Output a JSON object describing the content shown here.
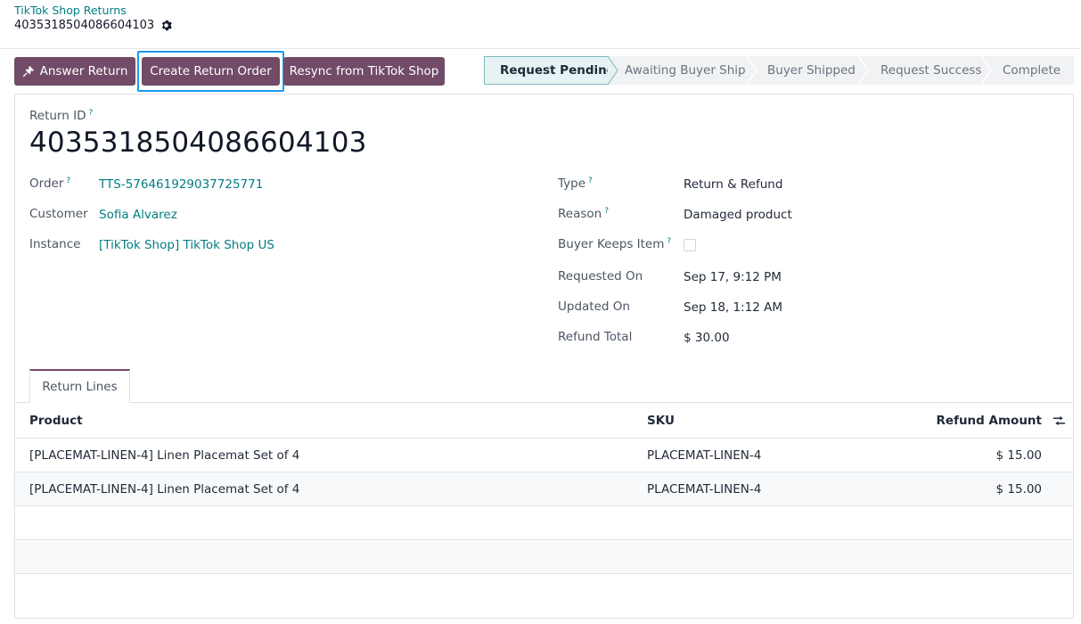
{
  "breadcrumb": {
    "parent": "TikTok Shop Returns",
    "record": "403531850408660410​3"
  },
  "actions": {
    "answer_return": "Answer Return",
    "create_return_order": "Create Return Order",
    "resync": "Resync from TikTok Shop"
  },
  "statusbar": [
    {
      "label": "Request Pending",
      "active": true
    },
    {
      "label": "Awaiting Buyer Ship",
      "active": false
    },
    {
      "label": "Buyer Shipped",
      "active": false
    },
    {
      "label": "Request Success",
      "active": false
    },
    {
      "label": "Complete",
      "active": false
    }
  ],
  "form": {
    "return_id_label": "Return ID",
    "return_id": "4035318504086604103",
    "help_mark": "?",
    "left": {
      "order_label": "Order",
      "order": "TTS-576461929037725771",
      "customer_label": "Customer",
      "customer": "Sofia Alvarez",
      "instance_label": "Instance",
      "instance": "[TikTok Shop] TikTok Shop US"
    },
    "right": {
      "type_label": "Type",
      "type": "Return & Refund",
      "reason_label": "Reason",
      "reason": "Damaged product",
      "keeps_label": "Buyer Keeps Item",
      "keeps": false,
      "requested_label": "Requested On",
      "requested": "Sep 17, 9:12 PM",
      "updated_label": "Updated On",
      "updated": "Sep 18, 1:12 AM",
      "refund_label": "Refund Total",
      "refund": "$ 30.00"
    }
  },
  "tabs": {
    "return_lines": "Return Lines"
  },
  "table": {
    "columns": {
      "product": "Product",
      "sku": "SKU",
      "amount": "Refund Amount"
    },
    "rows": [
      {
        "product": "[PLACEMAT-LINEN-4] Linen Placemat Set of 4",
        "sku": "PLACEMAT-LINEN-4",
        "amount": "$ 15.00"
      },
      {
        "product": "[PLACEMAT-LINEN-4] Linen Placemat Set of 4",
        "sku": "PLACEMAT-LINEN-4",
        "amount": "$ 15.00"
      }
    ]
  },
  "colors": {
    "brand": "#714b67",
    "link": "#017e84",
    "focus": "#1d9bf0"
  }
}
